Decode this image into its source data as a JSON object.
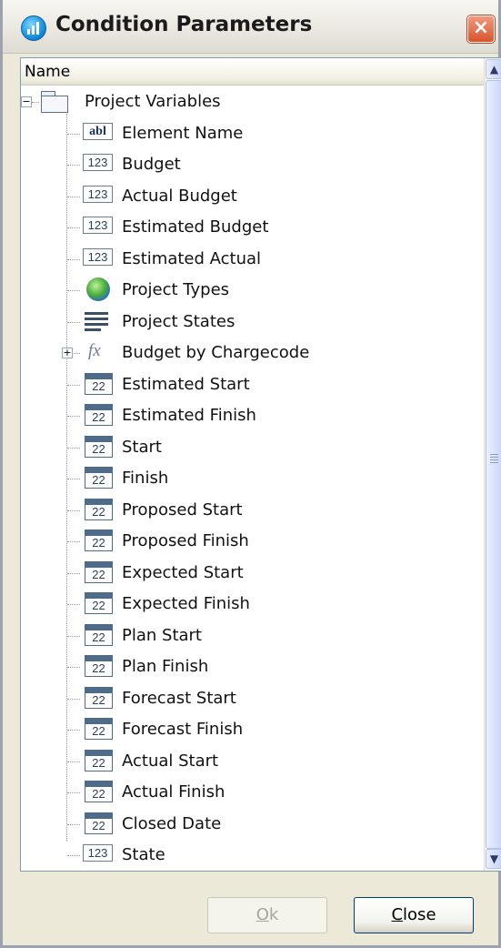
{
  "window": {
    "title": "Condition Parameters",
    "close_glyph": "×"
  },
  "tree": {
    "column_header": "Name",
    "root": {
      "label": "Project Variables",
      "icon": "folder-icon",
      "expander": "−"
    },
    "items": [
      {
        "label": "Element Name",
        "icon": "text-field-icon",
        "glyph": "abl"
      },
      {
        "label": "Budget",
        "icon": "number-icon",
        "glyph": "123"
      },
      {
        "label": "Actual Budget",
        "icon": "number-icon",
        "glyph": "123"
      },
      {
        "label": "Estimated Budget",
        "icon": "number-icon",
        "glyph": "123"
      },
      {
        "label": "Estimated Actual",
        "icon": "number-icon",
        "glyph": "123"
      },
      {
        "label": "Project Types",
        "icon": "globe-icon",
        "glyph": ""
      },
      {
        "label": "Project States",
        "icon": "list-icon",
        "glyph": ""
      },
      {
        "label": "Budget by Chargecode",
        "icon": "function-icon",
        "glyph": "fx",
        "expander": "+"
      },
      {
        "label": "Estimated Start",
        "icon": "date-icon",
        "glyph": "22"
      },
      {
        "label": "Estimated Finish",
        "icon": "date-icon",
        "glyph": "22"
      },
      {
        "label": "Start",
        "icon": "date-icon",
        "glyph": "22"
      },
      {
        "label": "Finish",
        "icon": "date-icon",
        "glyph": "22"
      },
      {
        "label": "Proposed Start",
        "icon": "date-icon",
        "glyph": "22"
      },
      {
        "label": "Proposed Finish",
        "icon": "date-icon",
        "glyph": "22"
      },
      {
        "label": "Expected Start",
        "icon": "date-icon",
        "glyph": "22"
      },
      {
        "label": "Expected Finish",
        "icon": "date-icon",
        "glyph": "22"
      },
      {
        "label": "Plan Start",
        "icon": "date-icon",
        "glyph": "22"
      },
      {
        "label": "Plan Finish",
        "icon": "date-icon",
        "glyph": "22"
      },
      {
        "label": "Forecast Start",
        "icon": "date-icon",
        "glyph": "22"
      },
      {
        "label": "Forecast Finish",
        "icon": "date-icon",
        "glyph": "22"
      },
      {
        "label": "Actual Start",
        "icon": "date-icon",
        "glyph": "22"
      },
      {
        "label": "Actual Finish",
        "icon": "date-icon",
        "glyph": "22"
      },
      {
        "label": "Closed Date",
        "icon": "date-icon",
        "glyph": "22"
      },
      {
        "label": "State",
        "icon": "number-icon",
        "glyph": "123"
      }
    ]
  },
  "scrollbar": {
    "up_glyph": "▲",
    "down_glyph": "▼"
  },
  "buttons": {
    "ok": "Ok",
    "ok_enabled": false,
    "close": "Close"
  },
  "colors": {
    "close_button": "#d8542c",
    "panel_border": "#7f9db9",
    "dialog_bg": "#ece9d8"
  }
}
